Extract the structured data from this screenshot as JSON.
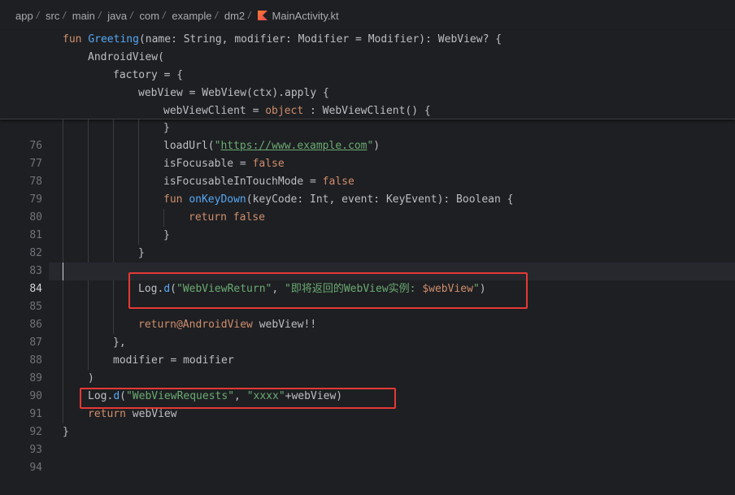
{
  "breadcrumb": {
    "items": [
      "app",
      "src",
      "main",
      "java",
      "com",
      "example",
      "dm2"
    ],
    "file": "MainActivity.kt"
  },
  "sticky_lines": [
    "fun Greeting(name: String, modifier: Modifier = Modifier): WebView? {",
    "    AndroidView(",
    "        factory = {",
    "            webView = WebView(ctx).apply {",
    "                webViewClient = object : WebViewClient() {"
  ],
  "editor": {
    "current_line": "84",
    "lines": [
      {
        "num": "76",
        "text": "                }"
      },
      {
        "num": "77",
        "pre": "                loadUrl(\"",
        "url": "https://www.example.com",
        "post": "\")"
      },
      {
        "num": "78",
        "text": "                isFocusable = false"
      },
      {
        "num": "79",
        "text": "                isFocusableInTouchMode = false"
      },
      {
        "num": "80",
        "text": "                fun onKeyDown(keyCode: Int, event: KeyEvent): Boolean {"
      },
      {
        "num": "81",
        "text": "                    return false"
      },
      {
        "num": "82",
        "text": "                }"
      },
      {
        "num": "83",
        "text": "            }"
      },
      {
        "num": "84",
        "text": ""
      },
      {
        "num": "85",
        "pre": "            Log.d(\"WebViewReturn\", \"即将返回的WebView实例: ",
        "tmpl": "$webView",
        "post": "\")"
      },
      {
        "num": "86",
        "text": ""
      },
      {
        "num": "87",
        "text": "            return@AndroidView webView!!"
      },
      {
        "num": "88",
        "text": "        },"
      },
      {
        "num": "89",
        "text": "        modifier = modifier"
      },
      {
        "num": "90",
        "text": "    )"
      },
      {
        "num": "91",
        "text": "    Log.d(\"WebViewRequests\", \"xxxx\"+webView)"
      },
      {
        "num": "92",
        "text": "    return webView"
      },
      {
        "num": "93",
        "text": "}"
      },
      {
        "num": "94",
        "text": ""
      }
    ]
  },
  "colors": {
    "background": "#1e1f22",
    "keyword": "#cf8e6d",
    "function": "#56a8f5",
    "string": "#6aab73",
    "highlight_box": "#e53935"
  }
}
